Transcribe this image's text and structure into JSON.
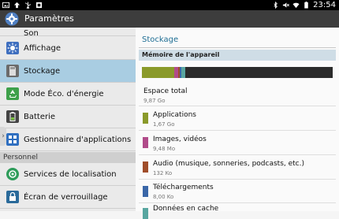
{
  "statusbar": {
    "time": "23:54"
  },
  "actionbar": {
    "title": "Paramètres"
  },
  "menu": {
    "partial_top": "Son",
    "items": [
      {
        "label": "Affichage",
        "color": "#3f6fbf"
      },
      {
        "label": "Stockage",
        "color": "#6b6b6b",
        "active": true
      },
      {
        "label": "Mode Éco. d'énergie",
        "color": "#3ea04a"
      },
      {
        "label": "Batterie",
        "color": "#444444"
      },
      {
        "label": "Gestionnaire d'applications",
        "color": "#2f6fc0"
      }
    ],
    "section": "Personnel",
    "items2": [
      {
        "label": "Services de localisation",
        "color": "#2e9c5a"
      },
      {
        "label": "Écran de verrouillage",
        "color": "#2a6a9a"
      }
    ]
  },
  "storage": {
    "title": "Stockage",
    "section": "Mémoire de l'appareil",
    "bar_segments": [
      {
        "name": "Applications",
        "fraction": 0.17,
        "color": "#8a9a2a"
      },
      {
        "name": "Images, vidéos",
        "fraction": 0.02,
        "color": "#b14b8a"
      },
      {
        "name": "Audio",
        "fraction": 0.01,
        "color": "#a04d2a"
      },
      {
        "name": "Téléchargements",
        "fraction": 0.01,
        "color": "#3a67a8"
      },
      {
        "name": "Données en cache",
        "fraction": 0.02,
        "color": "#58a6a0"
      }
    ],
    "total": {
      "label": "Espace total",
      "value": "9,87 Go"
    },
    "rows": [
      {
        "label": "Applications",
        "value": "1,67 Go",
        "color": "#8a9a2a"
      },
      {
        "label": "Images, vidéos",
        "value": "9,48 Mo",
        "color": "#b14b8a"
      },
      {
        "label": "Audio (musique, sonneries, podcasts, etc.)",
        "value": "132 Ko",
        "color": "#a04d2a"
      },
      {
        "label": "Téléchargements",
        "value": "8,00 Ko",
        "color": "#3a67a8"
      },
      {
        "label": "Données en cache",
        "value": "",
        "color": "#58a6a0"
      }
    ]
  }
}
